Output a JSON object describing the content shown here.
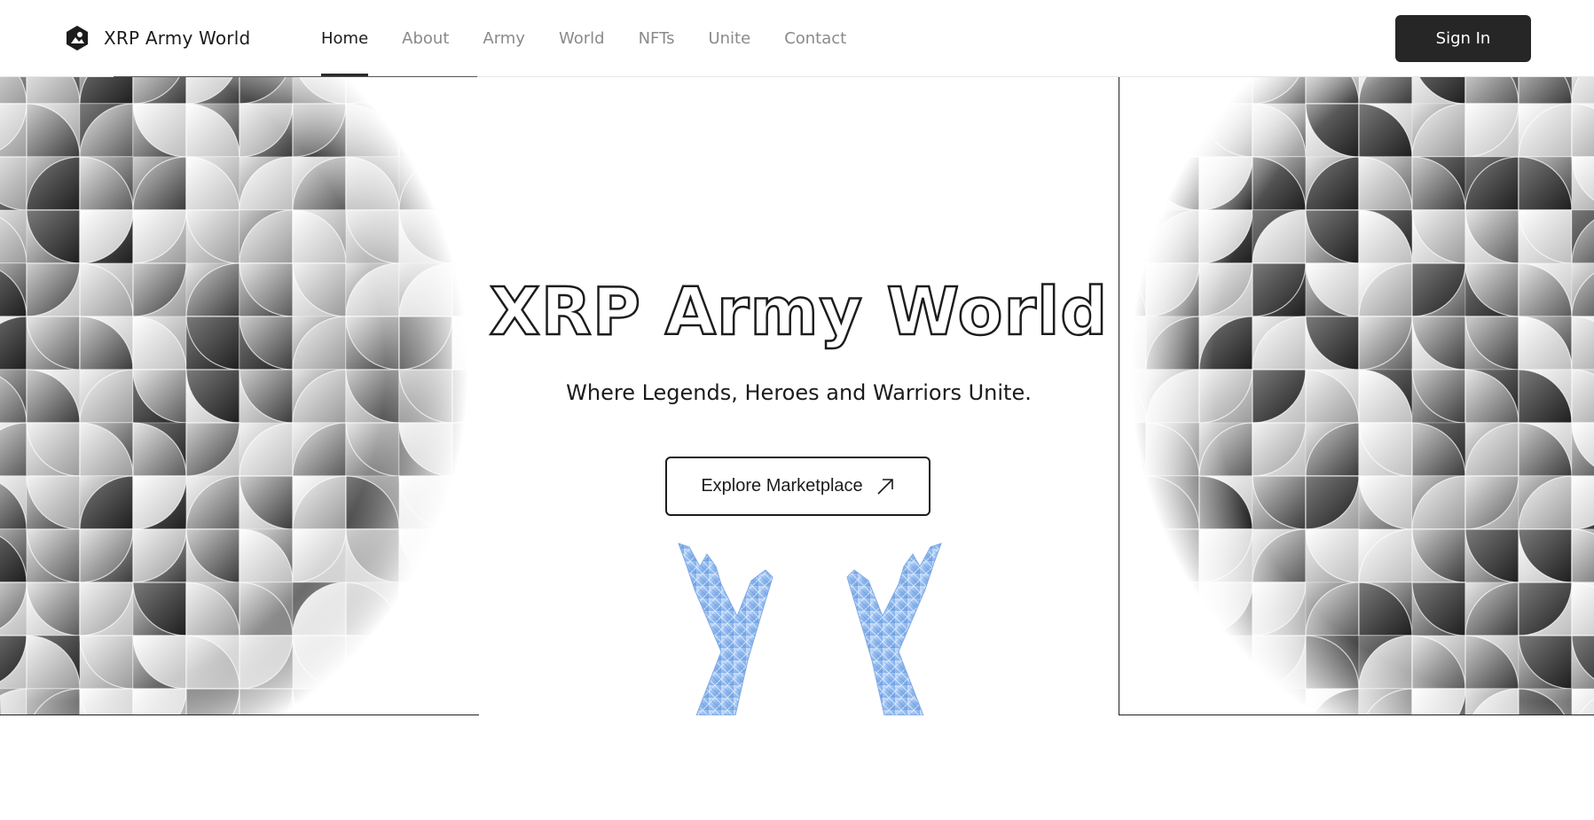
{
  "brand": {
    "name": "XRP Army World",
    "logo_icon": "hexagon-logo-icon"
  },
  "nav": {
    "items": [
      {
        "label": "Home",
        "active": true
      },
      {
        "label": "About",
        "active": false
      },
      {
        "label": "Army",
        "active": false
      },
      {
        "label": "World",
        "active": false
      },
      {
        "label": "NFTs",
        "active": false
      },
      {
        "label": "Unite",
        "active": false
      },
      {
        "label": "Contact",
        "active": false
      }
    ],
    "signin_label": "Sign In"
  },
  "hero": {
    "title": "XRP Army World",
    "subtitle": "Where Legends, Heroes and Warriors Unite.",
    "cta_label": "Explore Marketplace",
    "cta_icon": "arrow-up-right-icon",
    "image": "crystal-hands-image"
  },
  "colors": {
    "text": "#1c1c1c",
    "button_dark": "#262626",
    "nav_inactive": "#8a8a8a",
    "crystal": "#8fb8ee"
  }
}
